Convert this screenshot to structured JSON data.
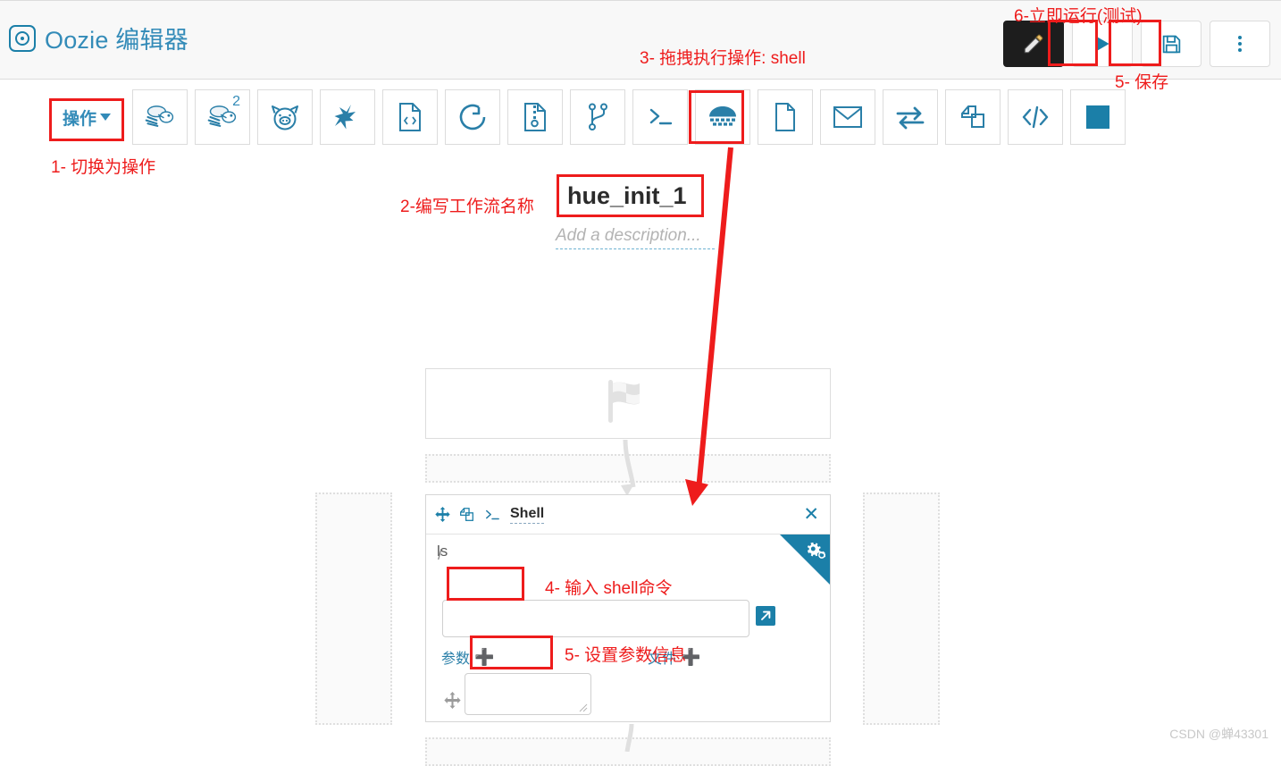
{
  "header": {
    "logo_icon": "oozie-target-logo-icon",
    "title": "Oozie 编辑器",
    "actions": [
      {
        "name": "edit-button",
        "icon": "pencil-icon",
        "label": ""
      },
      {
        "name": "run-button",
        "icon": "play-triangle-icon",
        "label": ""
      },
      {
        "name": "save-button",
        "icon": "floppy-disk-icon",
        "label": ""
      },
      {
        "name": "more-button",
        "icon": "kebab-menu-icon",
        "label": ""
      }
    ]
  },
  "toolbar": {
    "ops_label": "操作",
    "ops_caret_icon": "caret-down-icon",
    "tiles": [
      {
        "name": "tool-hive",
        "icon": "hive-bee-icon",
        "badge": ""
      },
      {
        "name": "tool-hive-server2",
        "icon": "hive-bee-icon",
        "badge": "2"
      },
      {
        "name": "tool-pig",
        "icon": "pig-icon",
        "badge": ""
      },
      {
        "name": "tool-spark",
        "icon": "spark-star-icon",
        "badge": ""
      },
      {
        "name": "tool-java",
        "icon": "code-document-icon",
        "badge": ""
      },
      {
        "name": "tool-sqoop",
        "icon": "circle-arrow-icon",
        "badge": ""
      },
      {
        "name": "tool-distcp",
        "icon": "file-zip-icon",
        "badge": ""
      },
      {
        "name": "tool-fork",
        "icon": "git-branch-icon",
        "badge": ""
      },
      {
        "name": "tool-shell",
        "icon": "terminal-prompt-icon",
        "badge": ""
      },
      {
        "name": "tool-hadoop",
        "icon": "hadoop-elephant-icon",
        "badge": ""
      },
      {
        "name": "tool-fs",
        "icon": "blank-page-icon",
        "badge": ""
      },
      {
        "name": "tool-email",
        "icon": "envelope-icon",
        "badge": ""
      },
      {
        "name": "tool-streaming",
        "icon": "two-arrows-icon",
        "badge": ""
      },
      {
        "name": "tool-subworkflow",
        "icon": "copy-pages-icon",
        "badge": ""
      },
      {
        "name": "tool-generic",
        "icon": "angle-brackets-icon",
        "badge": ""
      },
      {
        "name": "tool-kill",
        "icon": "filled-square-icon",
        "badge": ""
      }
    ]
  },
  "workflow": {
    "name": "hue_init_1",
    "description_placeholder": "Add a description..."
  },
  "canvas": {
    "start_node_icon": "checkered-flag-icon",
    "shell_node": {
      "drag_icon": "move-arrows-icon",
      "clone_icon": "copy-pages-icon",
      "type_icon": "terminal-prompt-icon",
      "title": "Shell",
      "close_icon": "close-x-icon",
      "gear_icon": "gears-settings-icon",
      "command_value": "ls",
      "expand_icon": "expand-arrow-icon",
      "params_label": "参数",
      "params_plus_icon": "plus-icon",
      "files_label": "文件",
      "files_plus_icon": "plus-icon",
      "param_drag_icon": "move-arrows-icon",
      "param_value": "/"
    }
  },
  "annotations": {
    "accent_color": "#ee1c1c",
    "items": [
      {
        "name": "annotation-1",
        "text": "1- 切换为操作"
      },
      {
        "name": "annotation-2",
        "text": "2-编写工作流名称"
      },
      {
        "name": "annotation-3",
        "text": "3- 拖拽执行操作: shell"
      },
      {
        "name": "annotation-4",
        "text": "4- 输入 shell命令"
      },
      {
        "name": "annotation-5",
        "text": "5- 设置参数信息"
      },
      {
        "name": "annotation-5b",
        "text": "5- 保存"
      },
      {
        "name": "annotation-6",
        "text": "6-立即运行(测试)"
      }
    ]
  },
  "watermark": {
    "text": "CSDN @蝉43301"
  },
  "colors": {
    "brand_blue": "#338bb8",
    "icon_blue": "#1b7fa8",
    "annotation_red": "#ee1c1c",
    "header_bg": "#f8f8f8"
  }
}
